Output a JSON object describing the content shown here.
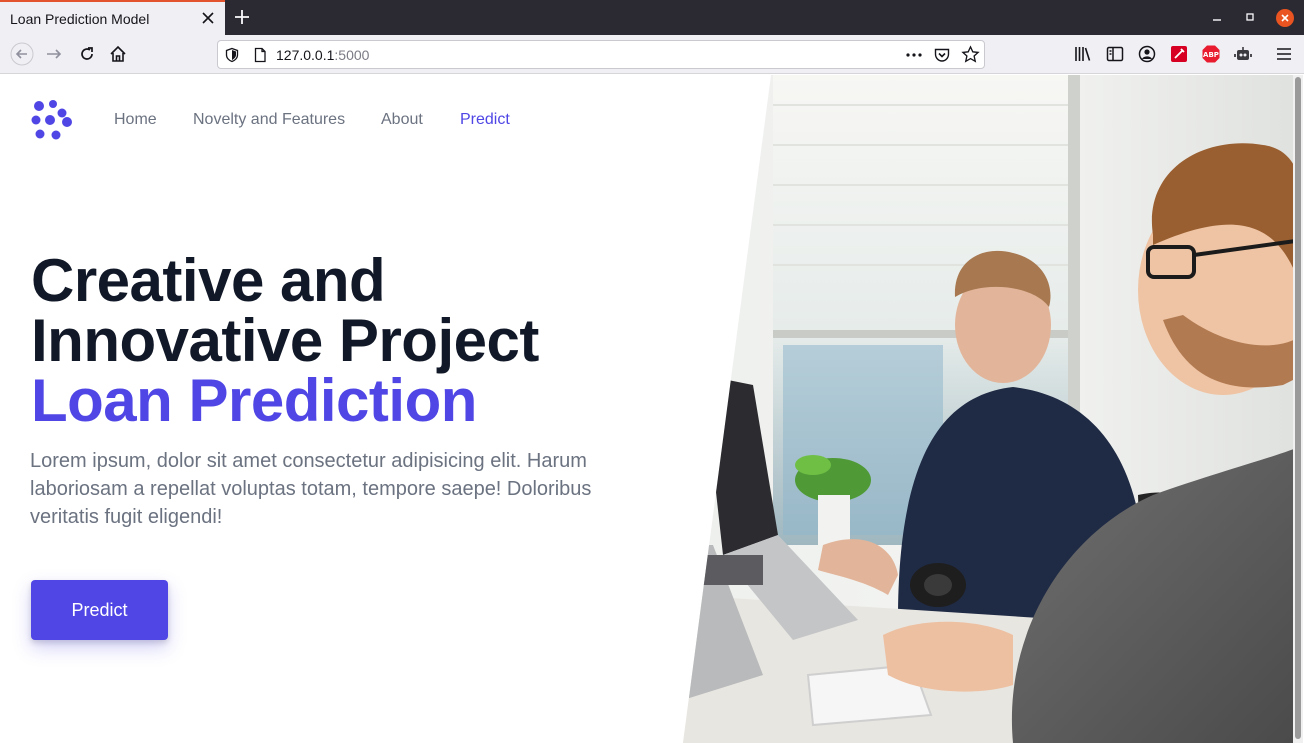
{
  "browser": {
    "tab_title": "Loan Prediction Model",
    "url_host": "127.0.0.1",
    "url_port": ":5000",
    "accent_color": "#e2532e"
  },
  "nav": {
    "items": [
      {
        "label": "Home",
        "active": false
      },
      {
        "label": "Novelty and Features",
        "active": false
      },
      {
        "label": "About",
        "active": false
      },
      {
        "label": "Predict",
        "active": true
      }
    ]
  },
  "hero": {
    "line1": "Creative and",
    "line2": "Innovative Project",
    "line3": "Loan Prediction",
    "description": "Lorem ipsum, dolor sit amet consectetur adipisicing elit. Harum laboriosam a repellat voluptas totam, tempore saepe! Doloribus veritatis fugit eligendi!",
    "button_label": "Predict"
  },
  "colors": {
    "primary": "#4f46e5",
    "heading": "#111827",
    "body_text": "#6b7280"
  }
}
